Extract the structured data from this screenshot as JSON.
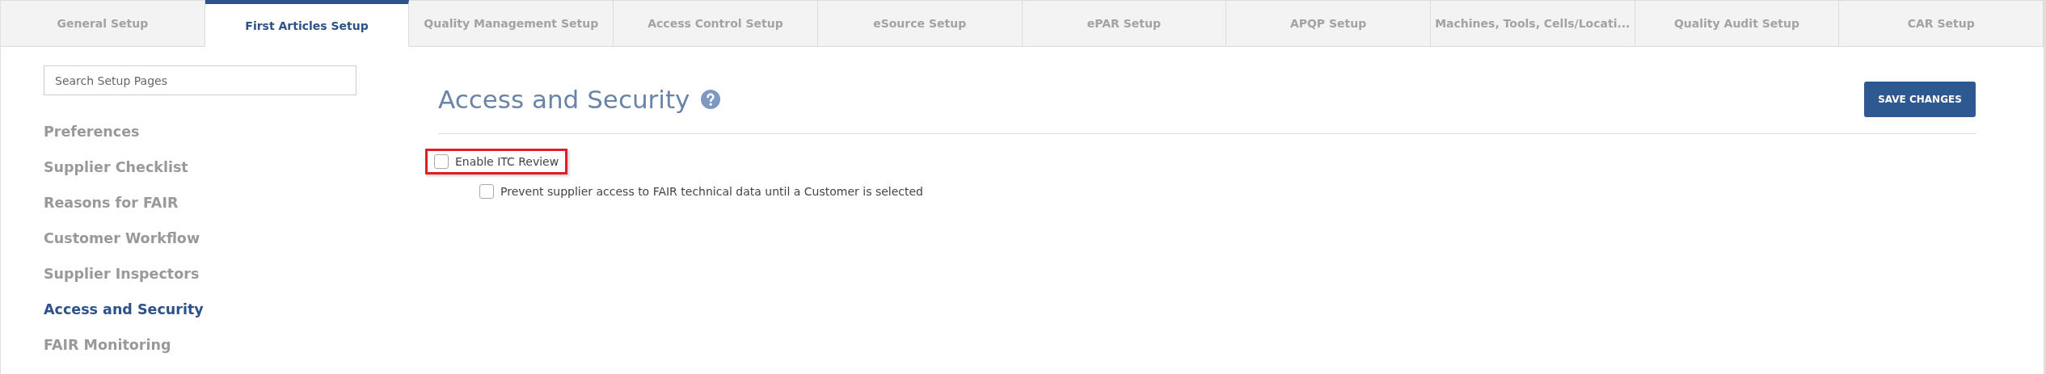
{
  "tabs": [
    {
      "label": "General Setup",
      "selected": false
    },
    {
      "label": "First Articles Setup",
      "selected": true
    },
    {
      "label": "Quality Management Setup",
      "selected": false
    },
    {
      "label": "Access Control Setup",
      "selected": false
    },
    {
      "label": "eSource Setup",
      "selected": false
    },
    {
      "label": "ePAR Setup",
      "selected": false
    },
    {
      "label": "APQP Setup",
      "selected": false
    },
    {
      "label": "Machines, Tools, Cells/Locati...",
      "selected": false
    },
    {
      "label": "Quality Audit Setup",
      "selected": false
    },
    {
      "label": "CAR Setup",
      "selected": false
    }
  ],
  "sidebar": {
    "search": {
      "placeholder": "Search Setup Pages"
    },
    "items": [
      {
        "label": "Preferences",
        "selected": false
      },
      {
        "label": "Supplier Checklist",
        "selected": false
      },
      {
        "label": "Reasons for FAIR",
        "selected": false
      },
      {
        "label": "Customer Workflow",
        "selected": false
      },
      {
        "label": "Supplier Inspectors",
        "selected": false
      },
      {
        "label": "Access and Security",
        "selected": true
      },
      {
        "label": "FAIR Monitoring",
        "selected": false
      }
    ]
  },
  "page": {
    "title": "Access and Security",
    "save_button": "SAVE CHANGES",
    "options": [
      {
        "label": "Enable ITC Review",
        "checked": false,
        "highlighted": true,
        "children": [
          {
            "label": "Prevent supplier access to FAIR technical data until a Customer is selected",
            "checked": false,
            "highlighted": false
          }
        ]
      }
    ]
  }
}
